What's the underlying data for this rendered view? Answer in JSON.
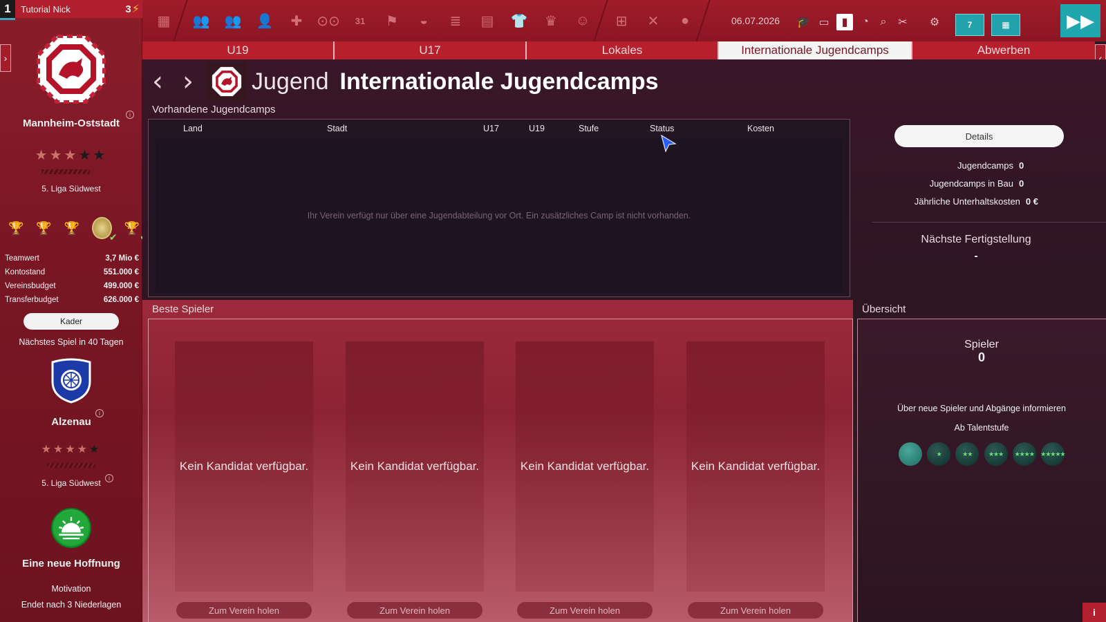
{
  "user": {
    "rank": "1",
    "name": "Tutorial Nick",
    "energy": "3"
  },
  "club": {
    "name": "Mannheim-Oststadt",
    "stars_on": 3,
    "stars_total": 5,
    "league": "5. Liga Südwest",
    "finance": [
      {
        "label": "Teamwert",
        "value": "3,7 Mio €"
      },
      {
        "label": "Kontostand",
        "value": "551.000 €"
      },
      {
        "label": "Vereinsbudget",
        "value": "499.000 €"
      },
      {
        "label": "Transferbudget",
        "value": "626.000 €"
      }
    ],
    "squad_button": "Kader"
  },
  "next_match": {
    "label": "Nächstes Spiel in 40 Tagen",
    "opponent": "Alzenau",
    "opponent_stars_on": 4,
    "opponent_league": "5. Liga Südwest"
  },
  "mood": {
    "title": "Eine neue Hoffnung",
    "label": "Motivation",
    "sub": "Endet nach 3 Niederlagen"
  },
  "toolbar": {
    "date": "06.07.2026",
    "calendar_week_label": "7",
    "icons": [
      "club-icon",
      "squad-icon",
      "squad-compare-icon",
      "youth-icon",
      "medical-icon",
      "scouting-icon",
      "calendar-icon",
      "training-icon",
      "stadium-icon",
      "finances-icon",
      "media-icon",
      "jersey-icon",
      "board-icon",
      "fans-icon",
      "tactics-board-icon",
      "tactics-icon",
      "profile-icon"
    ],
    "colors": {
      "active": "#ffffff",
      "accent": "#1fa6ae"
    }
  },
  "tabs": [
    {
      "label": "U19",
      "active": false
    },
    {
      "label": "U17",
      "active": false
    },
    {
      "label": "Lokales",
      "active": false
    },
    {
      "label": "Internationale Jugendcamps",
      "active": true
    },
    {
      "label": "Abwerben",
      "active": false
    }
  ],
  "page": {
    "prefix": "Jugend",
    "title": "Internationale Jugendcamps"
  },
  "camps": {
    "section_label": "Vorhandene Jugendcamps",
    "columns": [
      "Land",
      "Stadt",
      "U17",
      "U19",
      "Stufe",
      "Status",
      "Kosten"
    ],
    "rows": [],
    "empty_text": "Ihr Verein verfügt nur über eine Jugendabteilung vor Ort. Ein zusätzliches Camp ist nicht vorhanden."
  },
  "summary": {
    "details_button": "Details",
    "stats": [
      {
        "label": "Jugendcamps",
        "value": "0"
      },
      {
        "label": "Jugendcamps in Bau",
        "value": "0"
      },
      {
        "label": "Jährliche Unterhaltskosten",
        "value": "0 €"
      }
    ],
    "next_completion_label": "Nächste Fertigstellung",
    "next_completion_value": "-"
  },
  "best_players": {
    "section_label": "Beste Spieler",
    "cards": [
      {
        "text": "Kein Kandidat verfügbar.",
        "button": "Zum Verein holen"
      },
      {
        "text": "Kein Kandidat verfügbar.",
        "button": "Zum Verein holen"
      },
      {
        "text": "Kein Kandidat verfügbar.",
        "button": "Zum Verein holen"
      },
      {
        "text": "Kein Kandidat verfügbar.",
        "button": "Zum Verein holen"
      }
    ]
  },
  "overview": {
    "section_label": "Übersicht",
    "players_label": "Spieler",
    "players_count": "0",
    "notify_text": "Über neue Spieler und Abgänge informieren",
    "talent_label": "Ab Talentstufe",
    "talent_levels": [
      0,
      1,
      2,
      3,
      4,
      5
    ],
    "selected_level": 0
  }
}
